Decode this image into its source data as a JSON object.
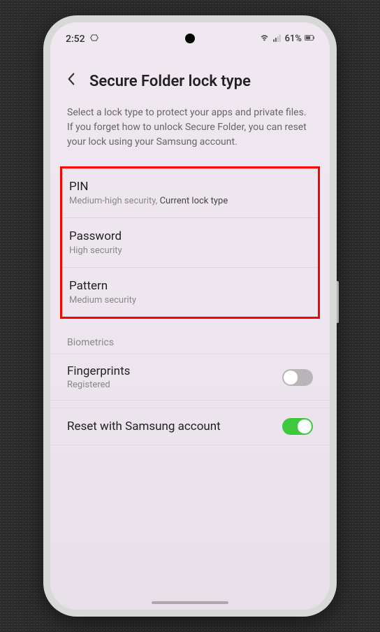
{
  "statusBar": {
    "time": "2:52",
    "batteryPercent": "61%"
  },
  "header": {
    "title": "Secure Folder lock type"
  },
  "description": "Select a lock type to protect your apps and private files. If you forget how to unlock Secure Folder, you can reset your lock using your Samsung account.",
  "lockTypes": [
    {
      "title": "PIN",
      "subtitle": "Medium-high security,",
      "current": "Current lock type"
    },
    {
      "title": "Password",
      "subtitle": "High security",
      "current": ""
    },
    {
      "title": "Pattern",
      "subtitle": "Medium security",
      "current": ""
    }
  ],
  "biometrics": {
    "header": "Biometrics",
    "fingerprints": {
      "title": "Fingerprints",
      "subtitle": "Registered",
      "enabled": false
    }
  },
  "resetOption": {
    "title": "Reset with Samsung account",
    "enabled": true
  }
}
